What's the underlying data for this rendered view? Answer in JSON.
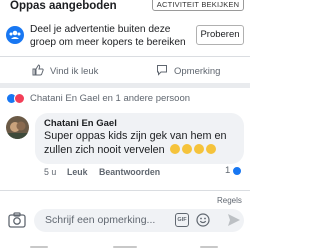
{
  "post": {
    "title": "Oppas aangeboden",
    "view_activity_label": "ACTIVITEIT BEKIJKEN"
  },
  "promo": {
    "text": "Deel je advertentie buiten deze groep om meer kopers te bereiken",
    "try_label": "Proberen"
  },
  "actions": {
    "like_label": "Vind ik leuk",
    "comment_label": "Opmerking"
  },
  "reactions": {
    "text": "Chatani En Gael en 1 andere persoon"
  },
  "comment": {
    "author": "Chatani En Gael",
    "text": "Super oppas kids zijn gek van hem en zullen zich nooit vervelen",
    "time": "5 u",
    "like_label": "Leuk",
    "reply_label": "Beantwoorden",
    "like_count": "1"
  },
  "rules_label": "Regels",
  "composer": {
    "placeholder": "Schrijf een opmerking...",
    "gif_label": "GIF"
  },
  "colors": {
    "like_blue": "#1877f2",
    "love_red": "#f33e58",
    "emoji_yellow": "#f5c33b"
  }
}
